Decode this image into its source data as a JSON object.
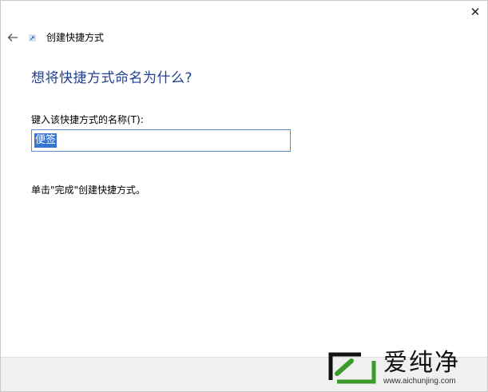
{
  "window": {
    "close_glyph": "✕"
  },
  "wizard": {
    "title": "创建快捷方式",
    "heading": "想将快捷方式命名为什么?",
    "field_label": "键入该快捷方式的名称(T):",
    "name_value": "便签",
    "hint": "单击\"完成\"创建快捷方式。"
  },
  "watermark": {
    "name": "爱纯净",
    "url": "www.aichunjing.com",
    "logo_color": "#3a9a2a"
  },
  "colors": {
    "heading": "#1f3f8f",
    "input_border": "#5b8cc7",
    "selection": "#3575d3"
  }
}
